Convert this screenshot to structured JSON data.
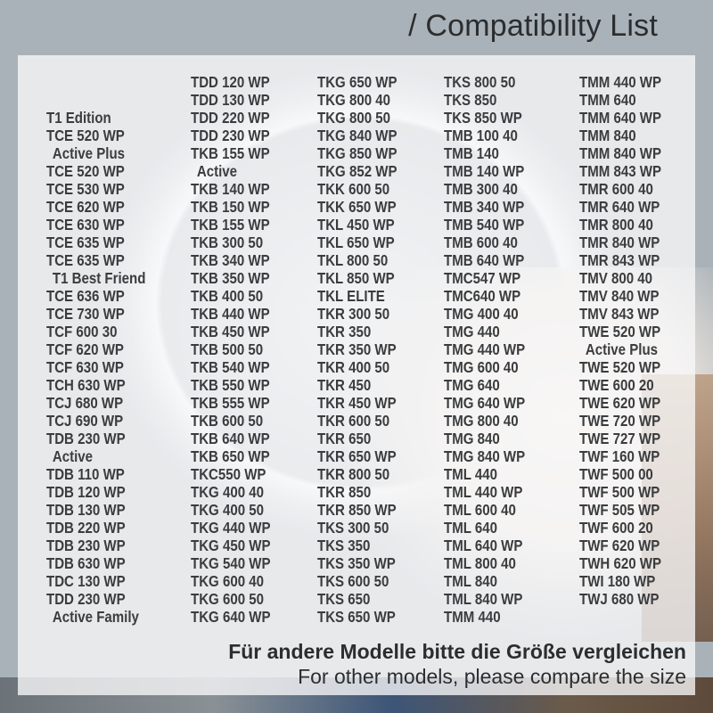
{
  "title": "/ Compatibility List",
  "columns": [
    {
      "items": [
        {
          "text": "",
          "sub": false,
          "spacer": true
        },
        {
          "text": "",
          "sub": false,
          "spacer": true
        },
        {
          "text": "T1 Edition",
          "sub": false
        },
        {
          "text": "TCE 520 WP",
          "sub": false
        },
        {
          "text": "Active Plus",
          "sub": true
        },
        {
          "text": "TCE 520 WP",
          "sub": false
        },
        {
          "text": "TCE 530 WP",
          "sub": false
        },
        {
          "text": "TCE 620 WP",
          "sub": false
        },
        {
          "text": "TCE 630 WP",
          "sub": false
        },
        {
          "text": "TCE 635 WP",
          "sub": false
        },
        {
          "text": "TCE 635 WP",
          "sub": false
        },
        {
          "text": "T1 Best Friend",
          "sub": true
        },
        {
          "text": "TCE 636 WP",
          "sub": false
        },
        {
          "text": "TCE 730 WP",
          "sub": false
        },
        {
          "text": "TCF 600 30",
          "sub": false
        },
        {
          "text": "TCF 620 WP",
          "sub": false
        },
        {
          "text": "TCF 630 WP",
          "sub": false
        },
        {
          "text": "TCH 630 WP",
          "sub": false
        },
        {
          "text": "TCJ 680 WP",
          "sub": false
        },
        {
          "text": "TCJ 690 WP",
          "sub": false
        },
        {
          "text": "TDB 230 WP",
          "sub": false
        },
        {
          "text": "Active",
          "sub": true
        },
        {
          "text": "TDB 110 WP",
          "sub": false
        },
        {
          "text": "TDB 120 WP",
          "sub": false
        },
        {
          "text": "TDB 130 WP",
          "sub": false
        },
        {
          "text": "TDB 220 WP",
          "sub": false
        },
        {
          "text": "TDB 230 WP",
          "sub": false
        },
        {
          "text": "TDB 630 WP",
          "sub": false
        },
        {
          "text": "TDC 130 WP",
          "sub": false
        },
        {
          "text": "TDD 230 WP",
          "sub": false
        },
        {
          "text": "Active Family",
          "sub": true
        }
      ]
    },
    {
      "items": [
        {
          "text": "TDD 120 WP",
          "sub": false
        },
        {
          "text": "TDD 130 WP",
          "sub": false
        },
        {
          "text": "TDD 220 WP",
          "sub": false
        },
        {
          "text": "TDD 230 WP",
          "sub": false
        },
        {
          "text": "TKB 155 WP",
          "sub": false
        },
        {
          "text": "Active",
          "sub": true
        },
        {
          "text": "TKB 140 WP",
          "sub": false
        },
        {
          "text": "TKB 150 WP",
          "sub": false
        },
        {
          "text": "TKB 155 WP",
          "sub": false
        },
        {
          "text": "TKB 300 50",
          "sub": false
        },
        {
          "text": "TKB 340 WP",
          "sub": false
        },
        {
          "text": "TKB 350 WP",
          "sub": false
        },
        {
          "text": "TKB 400 50",
          "sub": false
        },
        {
          "text": "TKB 440 WP",
          "sub": false
        },
        {
          "text": "TKB 450 WP",
          "sub": false
        },
        {
          "text": "TKB 500 50",
          "sub": false
        },
        {
          "text": "TKB 540 WP",
          "sub": false
        },
        {
          "text": "TKB 550 WP",
          "sub": false
        },
        {
          "text": "TKB 555 WP",
          "sub": false
        },
        {
          "text": "TKB 600 50",
          "sub": false
        },
        {
          "text": "TKB 640 WP",
          "sub": false
        },
        {
          "text": "TKB 650 WP",
          "sub": false
        },
        {
          "text": "TKC550 WP",
          "sub": false
        },
        {
          "text": "TKG 400 40",
          "sub": false
        },
        {
          "text": "TKG 400 50",
          "sub": false
        },
        {
          "text": "TKG 440 WP",
          "sub": false
        },
        {
          "text": "TKG 450 WP",
          "sub": false
        },
        {
          "text": "TKG 540 WP",
          "sub": false
        },
        {
          "text": "TKG 600 40",
          "sub": false
        },
        {
          "text": "TKG 600 50",
          "sub": false
        },
        {
          "text": "TKG 640 WP",
          "sub": false
        }
      ]
    },
    {
      "items": [
        {
          "text": "TKG 650 WP",
          "sub": false
        },
        {
          "text": "TKG 800 40",
          "sub": false
        },
        {
          "text": "TKG 800 50",
          "sub": false
        },
        {
          "text": "TKG 840 WP",
          "sub": false
        },
        {
          "text": "TKG 850 WP",
          "sub": false
        },
        {
          "text": "TKG 852 WP",
          "sub": false
        },
        {
          "text": "TKK 600 50",
          "sub": false
        },
        {
          "text": "TKK 650 WP",
          "sub": false
        },
        {
          "text": "TKL 450 WP",
          "sub": false
        },
        {
          "text": "TKL 650 WP",
          "sub": false
        },
        {
          "text": "TKL 800 50",
          "sub": false
        },
        {
          "text": "TKL 850 WP",
          "sub": false
        },
        {
          "text": "TKL ELITE",
          "sub": false
        },
        {
          "text": "TKR 300 50",
          "sub": false
        },
        {
          "text": "TKR 350",
          "sub": false
        },
        {
          "text": "TKR 350 WP",
          "sub": false
        },
        {
          "text": "TKR 400 50",
          "sub": false
        },
        {
          "text": "TKR 450",
          "sub": false
        },
        {
          "text": "TKR 450 WP",
          "sub": false
        },
        {
          "text": "TKR 600 50",
          "sub": false
        },
        {
          "text": "TKR 650",
          "sub": false
        },
        {
          "text": "TKR 650 WP",
          "sub": false
        },
        {
          "text": "TKR 800 50",
          "sub": false
        },
        {
          "text": "TKR 850",
          "sub": false
        },
        {
          "text": "TKR 850 WP",
          "sub": false
        },
        {
          "text": "TKS 300 50",
          "sub": false
        },
        {
          "text": "TKS 350",
          "sub": false
        },
        {
          "text": "TKS 350 WP",
          "sub": false
        },
        {
          "text": "TKS 600 50",
          "sub": false
        },
        {
          "text": "TKS 650",
          "sub": false
        },
        {
          "text": "TKS 650 WP",
          "sub": false
        }
      ]
    },
    {
      "items": [
        {
          "text": "TKS 800 50",
          "sub": false
        },
        {
          "text": "TKS 850",
          "sub": false
        },
        {
          "text": "TKS 850 WP",
          "sub": false
        },
        {
          "text": "TMB 100 40",
          "sub": false
        },
        {
          "text": "TMB 140",
          "sub": false
        },
        {
          "text": "TMB 140 WP",
          "sub": false
        },
        {
          "text": "TMB 300 40",
          "sub": false
        },
        {
          "text": "TMB 340 WP",
          "sub": false
        },
        {
          "text": "TMB 540 WP",
          "sub": false
        },
        {
          "text": "TMB 600 40",
          "sub": false
        },
        {
          "text": "TMB 640 WP",
          "sub": false
        },
        {
          "text": "TMC547 WP",
          "sub": false
        },
        {
          "text": "TMC640 WP",
          "sub": false
        },
        {
          "text": "TMG 400 40",
          "sub": false
        },
        {
          "text": "TMG 440",
          "sub": false
        },
        {
          "text": "TMG 440 WP",
          "sub": false
        },
        {
          "text": "TMG 600 40",
          "sub": false
        },
        {
          "text": "TMG 640",
          "sub": false
        },
        {
          "text": "TMG 640 WP",
          "sub": false
        },
        {
          "text": "TMG 800 40",
          "sub": false
        },
        {
          "text": "TMG 840",
          "sub": false
        },
        {
          "text": "TMG 840 WP",
          "sub": false
        },
        {
          "text": "TML 440",
          "sub": false
        },
        {
          "text": "TML 440 WP",
          "sub": false
        },
        {
          "text": "TML 600 40",
          "sub": false
        },
        {
          "text": "TML 640",
          "sub": false
        },
        {
          "text": "TML 640 WP",
          "sub": false
        },
        {
          "text": "TML 800 40",
          "sub": false
        },
        {
          "text": "TML 840",
          "sub": false
        },
        {
          "text": "TML 840 WP",
          "sub": false
        },
        {
          "text": "TMM 440",
          "sub": false
        }
      ]
    },
    {
      "items": [
        {
          "text": "TMM 440 WP",
          "sub": false
        },
        {
          "text": "TMM 640",
          "sub": false
        },
        {
          "text": "TMM 640 WP",
          "sub": false
        },
        {
          "text": "TMM 840",
          "sub": false
        },
        {
          "text": "TMM 840 WP",
          "sub": false
        },
        {
          "text": "TMM 843 WP",
          "sub": false
        },
        {
          "text": "TMR 600 40",
          "sub": false
        },
        {
          "text": "TMR 640 WP",
          "sub": false
        },
        {
          "text": "TMR 800 40",
          "sub": false
        },
        {
          "text": "TMR 840 WP",
          "sub": false
        },
        {
          "text": "TMR 843 WP",
          "sub": false
        },
        {
          "text": "TMV 800 40",
          "sub": false
        },
        {
          "text": "TMV 840 WP",
          "sub": false
        },
        {
          "text": "TMV 843 WP",
          "sub": false
        },
        {
          "text": "TWE 520 WP",
          "sub": false
        },
        {
          "text": "Active Plus",
          "sub": true
        },
        {
          "text": "TWE 520 WP",
          "sub": false
        },
        {
          "text": "TWE 600 20",
          "sub": false
        },
        {
          "text": "TWE 620 WP",
          "sub": false
        },
        {
          "text": "TWE 720 WP",
          "sub": false
        },
        {
          "text": "TWE 727 WP",
          "sub": false
        },
        {
          "text": "TWF 160 WP",
          "sub": false
        },
        {
          "text": "TWF 500 00",
          "sub": false
        },
        {
          "text": "TWF 500 WP",
          "sub": false
        },
        {
          "text": "TWF 505 WP",
          "sub": false
        },
        {
          "text": "TWF 600 20",
          "sub": false
        },
        {
          "text": "TWF 620 WP",
          "sub": false
        },
        {
          "text": "TWH 620 WP",
          "sub": false
        },
        {
          "text": "TWI 180 WP",
          "sub": false
        },
        {
          "text": "TWJ 680 WP",
          "sub": false
        }
      ]
    }
  ],
  "footer": {
    "note_de": "Für andere Modelle bitte die Größe vergleichen",
    "note_en": "For other models, please compare the size"
  }
}
